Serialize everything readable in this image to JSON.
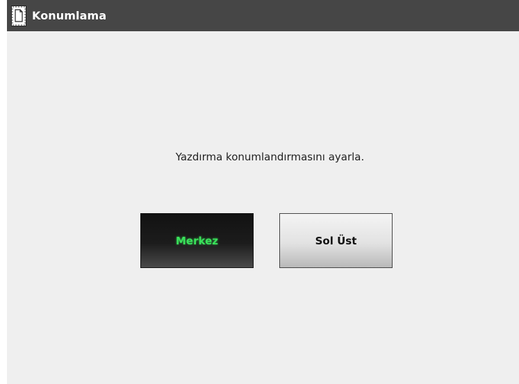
{
  "window": {
    "title": "Konumlama",
    "title_icon": "page-position-icon"
  },
  "message": "Yazdırma konumlandırmasını ayarla.",
  "buttons": {
    "center_label": "Merkez",
    "top_left_label": "Sol Üst",
    "selected": "Merkez"
  },
  "colors": {
    "title_bar": "#464646",
    "background": "#efefef",
    "selected_text": "#39e25a"
  }
}
